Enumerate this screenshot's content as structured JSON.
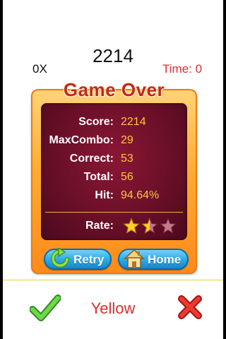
{
  "hud": {
    "combo": "0X",
    "score": "2214",
    "time_label": "Time:",
    "time_value": "0"
  },
  "game_over": {
    "title": "Game Over",
    "stats": [
      {
        "label": "Score:",
        "value": "2214"
      },
      {
        "label": "MaxCombo:",
        "value": "29"
      },
      {
        "label": "Correct:",
        "value": "53"
      },
      {
        "label": "Total:",
        "value": "56"
      },
      {
        "label": "Hit:",
        "value": "94.64%"
      }
    ],
    "rate_label": "Rate:",
    "rating": {
      "value": 1.5,
      "max": 3
    },
    "retry_label": "Retry",
    "home_label": "Home"
  },
  "bottom": {
    "color_word": "Yellow",
    "color_word_color": "#d93030"
  },
  "colors": {
    "accent_red": "#d93030",
    "value_yellow": "#ffc83a",
    "panel_orange": "#ffab2e",
    "inner_maroon": "#6a0f28",
    "button_blue": "#29a8e6"
  },
  "icons": [
    "retry-arrow-icon",
    "home-icon",
    "star-icon",
    "checkmark-icon",
    "cross-icon"
  ]
}
